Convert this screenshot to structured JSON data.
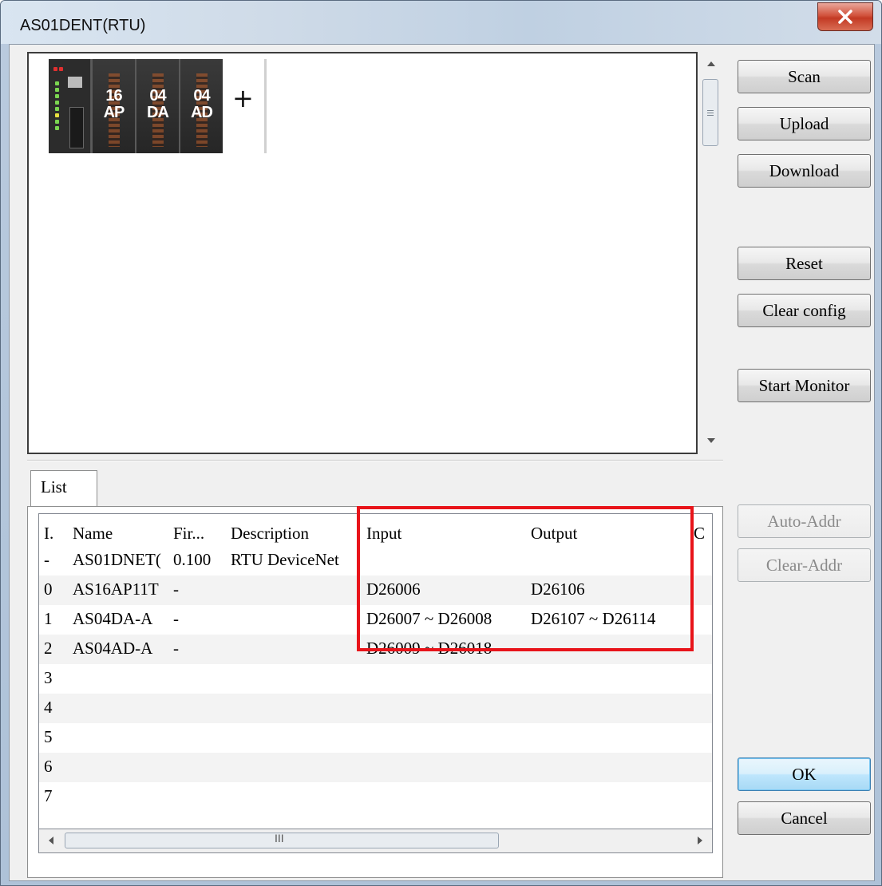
{
  "window": {
    "title": "AS01DENT(RTU)"
  },
  "rack": {
    "modules": [
      {
        "label_top": "16",
        "label_bottom": "AP"
      },
      {
        "label_top": "04",
        "label_bottom": "DA"
      },
      {
        "label_top": "04",
        "label_bottom": "AD"
      }
    ],
    "add_label": "+"
  },
  "buttons": {
    "scan": "Scan",
    "upload": "Upload",
    "download": "Download",
    "reset": "Reset",
    "clear_config": "Clear config",
    "start_monitor": "Start Monitor",
    "auto_addr": "Auto-Addr",
    "clear_addr": "Clear-Addr",
    "ok": "OK",
    "cancel": "Cancel"
  },
  "list": {
    "tab_label": "List",
    "columns": [
      "I.",
      "Name",
      "Fir...",
      "Description",
      "Input",
      "Output",
      "C"
    ],
    "rows": [
      {
        "index": "-",
        "name": "AS01DNET(",
        "firmware": "0.100",
        "description": "RTU DeviceNet",
        "input": "",
        "output": ""
      },
      {
        "index": "0",
        "name": "AS16AP11T",
        "firmware": "-",
        "description": "",
        "input": "D26006",
        "output": "D26106"
      },
      {
        "index": "1",
        "name": "AS04DA-A",
        "firmware": "-",
        "description": "",
        "input": "D26007 ~ D26008",
        "output": "D26107 ~ D26114"
      },
      {
        "index": "2",
        "name": "AS04AD-A",
        "firmware": "-",
        "description": "",
        "input": "D26009 ~ D26018",
        "output": ""
      },
      {
        "index": "3",
        "name": "",
        "firmware": "",
        "description": "",
        "input": "",
        "output": ""
      },
      {
        "index": "4",
        "name": "",
        "firmware": "",
        "description": "",
        "input": "",
        "output": ""
      },
      {
        "index": "5",
        "name": "",
        "firmware": "",
        "description": "",
        "input": "",
        "output": ""
      },
      {
        "index": "6",
        "name": "",
        "firmware": "",
        "description": "",
        "input": "",
        "output": ""
      },
      {
        "index": "7",
        "name": "",
        "firmware": "",
        "description": "",
        "input": "",
        "output": ""
      }
    ],
    "scroll_grip": "III"
  },
  "colors": {
    "highlight_border": "#e8141a",
    "close_button": "#c33a24"
  }
}
